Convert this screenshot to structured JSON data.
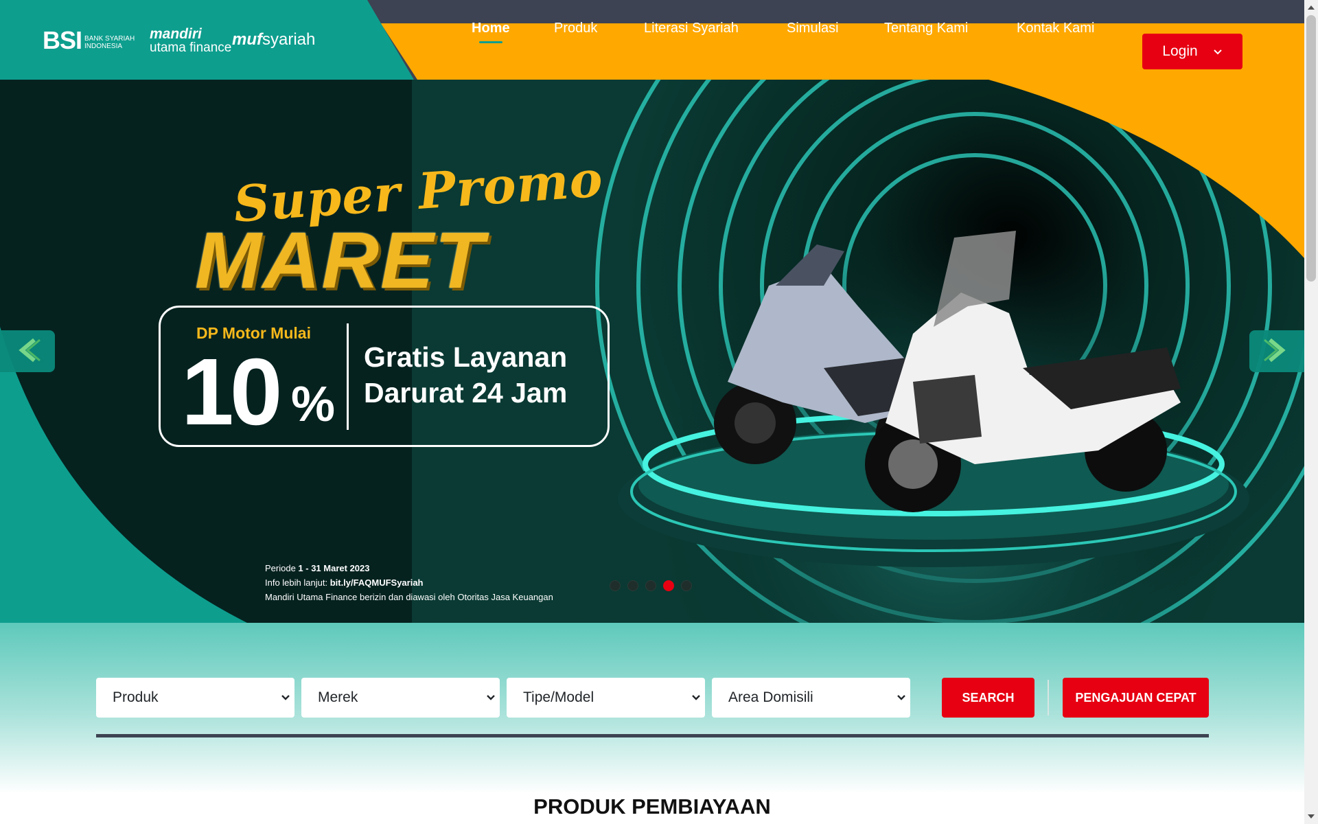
{
  "header": {
    "logos": {
      "bsi": {
        "mark": "BSI",
        "sub_line1": "BANK SYARIAH",
        "sub_line2": "INDONESIA"
      },
      "mandiri": {
        "line1": "mandiri",
        "line2": "utama finance"
      },
      "muf": {
        "bold": "muf",
        "rest": "syariah"
      }
    },
    "nav": [
      {
        "label": "Home",
        "active": true
      },
      {
        "label": "Produk",
        "active": false
      },
      {
        "label": "Literasi Syariah",
        "active": false
      },
      {
        "label": "Simulasi",
        "active": false
      },
      {
        "label": "Tentang Kami",
        "active": false
      },
      {
        "label": "Kontak Kami",
        "active": false
      }
    ],
    "login_label": "Login",
    "colors": {
      "navbar": "#ffa800",
      "topstrip": "#3d4352",
      "brand_teal": "#0e9e8e",
      "accent_red": "#e60012"
    }
  },
  "hero": {
    "script_title": "Super Promo",
    "title": "MARET",
    "dp_label": "DP Motor Mulai",
    "dp_value": "10",
    "dp_unit": "%",
    "gratis_line1": "Gratis Layanan",
    "gratis_line2": "Darurat 24 Jam",
    "periode_prefix": "Periode ",
    "periode_value": "1 - 31 Maret 2023",
    "info_prefix": "Info lebih lanjut: ",
    "info_link": "bit.ly/FAQMUFSyariah",
    "disclaimer": "Mandiri Utama Finance berizin dan diawasi oleh Otoritas Jasa Keuangan",
    "prev_icon": "chevron-left-icon",
    "next_icon": "chevron-right-icon",
    "slides_total": 5,
    "active_slide": 4
  },
  "search": {
    "selects": [
      {
        "value": "Produk"
      },
      {
        "value": "Merek"
      },
      {
        "value": "Tipe/Model"
      },
      {
        "value": "Area Domisili"
      }
    ],
    "search_label": "SEARCH",
    "quick_label": "PENGAJUAN CEPAT"
  },
  "section_title": "PRODUK PEMBIAYAAN"
}
